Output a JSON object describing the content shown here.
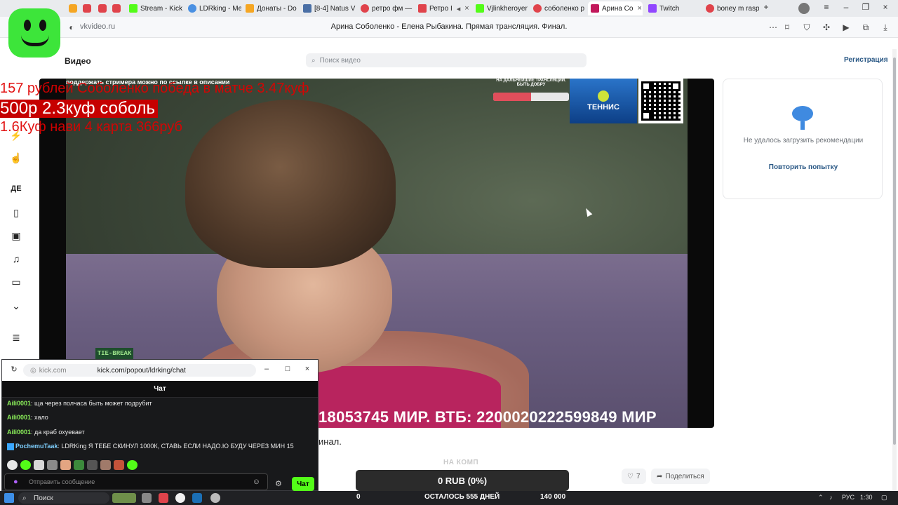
{
  "browser": {
    "tabs": [
      {
        "label": "Stream - Kick",
        "color": "#53fc18"
      },
      {
        "label": "LDRking - Me",
        "color": "#4a90e2"
      },
      {
        "label": "Донаты - Do",
        "color": "#f5a623"
      },
      {
        "label": "[8-4] Natus V",
        "color": "#4a6fa5"
      },
      {
        "label": "ретро фм —",
        "color": "#e0434b"
      },
      {
        "label": "Ретро I",
        "color": "#e0434b"
      },
      {
        "label": "Vjlinkheroyer",
        "color": "#53fc18"
      },
      {
        "label": "соболенко р",
        "color": "#e0434b"
      },
      {
        "label": "Арина Со",
        "color": "#c2185b"
      },
      {
        "label": "Twitch",
        "color": "#9146ff"
      },
      {
        "label": "boney m rasp",
        "color": "#e0434b"
      }
    ],
    "url": "vkvideo.ru",
    "page_title": "Арина Соболенко - Елена Рыбакина. Прямая трансляция. Финал."
  },
  "vk": {
    "brand": "Видео",
    "search_placeholder": "Поиск видео",
    "register": "Регистрация"
  },
  "overlay": {
    "line1": "157 рублей Соболенко победа в матче 3.47куф",
    "line2": "500р 2.3куф соболь",
    "line3": "1.6Куф нави 4 карта 366руб"
  },
  "video": {
    "top_note": "поддержать стримера можно по ссылке в описании",
    "donation_caption": "НА ДАЛЬНЕЙШИЕ ТРАНСЛЯЦИИ. БЫТЬ ДОБРУ",
    "donation_progress": 0.5,
    "tennis_logo": "ТЕННИС",
    "tiebreak": "TIE-BREAK",
    "ticker": "18053745 МИР. ВТБ: 2200020222599849 МИР"
  },
  "recommendations": {
    "error_text": "Не удалось загрузить рекомендации",
    "retry": "Повторить попытку"
  },
  "below_video": {
    "title_tail": "инал.",
    "na_komp": "НА КОМП",
    "rub_status": "0 RUB (0%)",
    "likes": "7",
    "share": "Поделиться"
  },
  "chat": {
    "url_prefix": "kick.com",
    "url_path": "kick.com/popout/ldrking/chat",
    "header": "Чат",
    "messages": [
      {
        "user": "Aili0001",
        "text": "ща через полчаса быть может подрубит"
      },
      {
        "user": "Aili0001",
        "text": "хало"
      },
      {
        "user": "Aili0001",
        "text": "да краб охуевает"
      },
      {
        "user": "PochemuTaak",
        "text": "LDRKing Я ТЕБЕ СКИНУЛ 1000К, СТАВЬ ЕСЛИ НАДО.Ю БУДУ ЧЕРЕЗ МИН 15"
      }
    ],
    "input_placeholder": "Отправить сообщение",
    "send": "Чат"
  },
  "taskbar": {
    "search": "Поиск",
    "stat_left": "0",
    "stat_center": "ОСТАЛОСЬ 555 ДНЕЙ",
    "stat_right": "140 000",
    "lang": "РУС",
    "time": "1:30"
  }
}
